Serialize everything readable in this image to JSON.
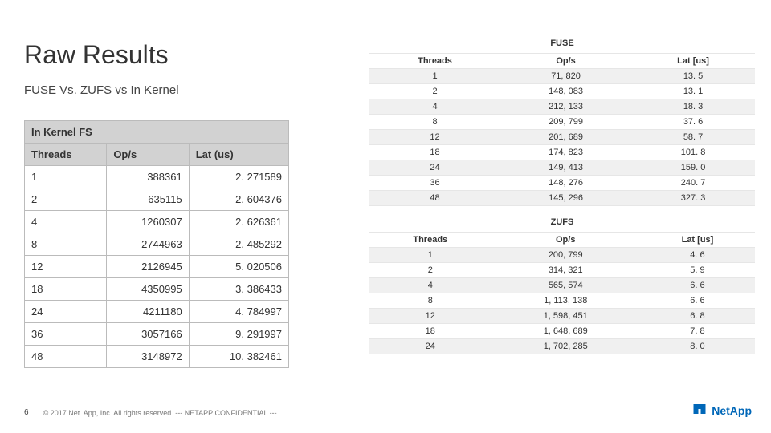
{
  "title": "Raw Results",
  "subtitle": "FUSE Vs. ZUFS vs In Kernel",
  "left": {
    "caption": "In Kernel FS",
    "headers": [
      "Threads",
      "Op/s",
      "Lat (us)"
    ],
    "rows": [
      [
        "1",
        "388361",
        "2. 271589"
      ],
      [
        "2",
        "635115",
        "2. 604376"
      ],
      [
        "4",
        "1260307",
        "2. 626361"
      ],
      [
        "8",
        "2744963",
        "2. 485292"
      ],
      [
        "12",
        "2126945",
        "5. 020506"
      ],
      [
        "18",
        "4350995",
        "3. 386433"
      ],
      [
        "24",
        "4211180",
        "4. 784997"
      ],
      [
        "36",
        "3057166",
        "9. 291997"
      ],
      [
        "48",
        "3148972",
        "10. 382461"
      ]
    ]
  },
  "right": {
    "headers": [
      "Threads",
      "Op/s",
      "Lat [us]"
    ],
    "fuse": {
      "title": "FUSE",
      "rows": [
        [
          "1",
          "71, 820",
          "13. 5"
        ],
        [
          "2",
          "148, 083",
          "13. 1"
        ],
        [
          "4",
          "212, 133",
          "18. 3"
        ],
        [
          "8",
          "209, 799",
          "37. 6"
        ],
        [
          "12",
          "201, 689",
          "58. 7"
        ],
        [
          "18",
          "174, 823",
          "101. 8"
        ],
        [
          "24",
          "149, 413",
          "159. 0"
        ],
        [
          "36",
          "148, 276",
          "240. 7"
        ],
        [
          "48",
          "145, 296",
          "327. 3"
        ]
      ]
    },
    "zufs": {
      "title": "ZUFS",
      "rows": [
        [
          "1",
          "200, 799",
          "4. 6"
        ],
        [
          "2",
          "314, 321",
          "5. 9"
        ],
        [
          "4",
          "565, 574",
          "6. 6"
        ],
        [
          "8",
          "1, 113, 138",
          "6. 6"
        ],
        [
          "12",
          "1, 598, 451",
          "6. 8"
        ],
        [
          "18",
          "1, 648, 689",
          "7. 8"
        ],
        [
          "24",
          "1, 702, 285",
          "8. 0"
        ]
      ]
    }
  },
  "footer": {
    "page": "6",
    "copyright": "© 2017 Net. App, Inc. All rights reserved. --- NETAPP CONFIDENTIAL ---"
  },
  "logo": {
    "text": "NetApp"
  },
  "chart_data": [
    {
      "type": "table",
      "title": "In Kernel FS",
      "columns": [
        "Threads",
        "Op/s",
        "Lat (us)"
      ],
      "rows": [
        [
          1,
          388361,
          2.271589
        ],
        [
          2,
          635115,
          2.604376
        ],
        [
          4,
          1260307,
          2.626361
        ],
        [
          8,
          2744963,
          2.485292
        ],
        [
          12,
          2126945,
          5.020506
        ],
        [
          18,
          4350995,
          3.386433
        ],
        [
          24,
          4211180,
          4.784997
        ],
        [
          36,
          3057166,
          9.291997
        ],
        [
          48,
          3148972,
          10.382461
        ]
      ]
    },
    {
      "type": "table",
      "title": "FUSE",
      "columns": [
        "Threads",
        "Op/s",
        "Lat [us]"
      ],
      "rows": [
        [
          1,
          71820,
          13.5
        ],
        [
          2,
          148083,
          13.1
        ],
        [
          4,
          212133,
          18.3
        ],
        [
          8,
          209799,
          37.6
        ],
        [
          12,
          201689,
          58.7
        ],
        [
          18,
          174823,
          101.8
        ],
        [
          24,
          149413,
          159.0
        ],
        [
          36,
          148276,
          240.7
        ],
        [
          48,
          145296,
          327.3
        ]
      ]
    },
    {
      "type": "table",
      "title": "ZUFS",
      "columns": [
        "Threads",
        "Op/s",
        "Lat [us]"
      ],
      "rows": [
        [
          1,
          200799,
          4.6
        ],
        [
          2,
          314321,
          5.9
        ],
        [
          4,
          565574,
          6.6
        ],
        [
          8,
          1113138,
          6.6
        ],
        [
          12,
          1598451,
          6.8
        ],
        [
          18,
          1648689,
          7.8
        ],
        [
          24,
          1702285,
          8.0
        ]
      ]
    }
  ]
}
